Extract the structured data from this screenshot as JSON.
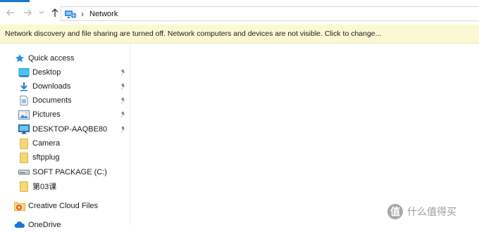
{
  "address_bar": {
    "breadcrumb_separator": "›",
    "location": "Network"
  },
  "notification": "Network discovery and file sharing are turned off. Network computers and devices are not visible. Click to change...",
  "sidebar": {
    "quick_access": "Quick access",
    "items": [
      {
        "label": "Desktop",
        "icon": "desktop-icon",
        "pinned": true
      },
      {
        "label": "Downloads",
        "icon": "download-icon",
        "pinned": true
      },
      {
        "label": "Documents",
        "icon": "documents-icon",
        "pinned": true
      },
      {
        "label": "Pictures",
        "icon": "pictures-icon",
        "pinned": true
      },
      {
        "label": "DESKTOP-AAQBE80",
        "icon": "computer-icon",
        "pinned": true
      },
      {
        "label": "Camera",
        "icon": "folder-icon",
        "pinned": false
      },
      {
        "label": "sftpplug",
        "icon": "folder-icon",
        "pinned": false
      },
      {
        "label": "SOFT PACKAGE (C:)",
        "icon": "drive-icon",
        "pinned": false
      },
      {
        "label": "第03课",
        "icon": "folder-icon",
        "pinned": false
      }
    ],
    "creative_cloud": "Creative Cloud Files",
    "onedrive": "OneDrive"
  },
  "watermark": {
    "logo_char": "值",
    "text": "什么值得买"
  },
  "colors": {
    "accent": "#1979ca",
    "infobar_bg": "#fbf9d2",
    "folder": "#f8d775"
  }
}
